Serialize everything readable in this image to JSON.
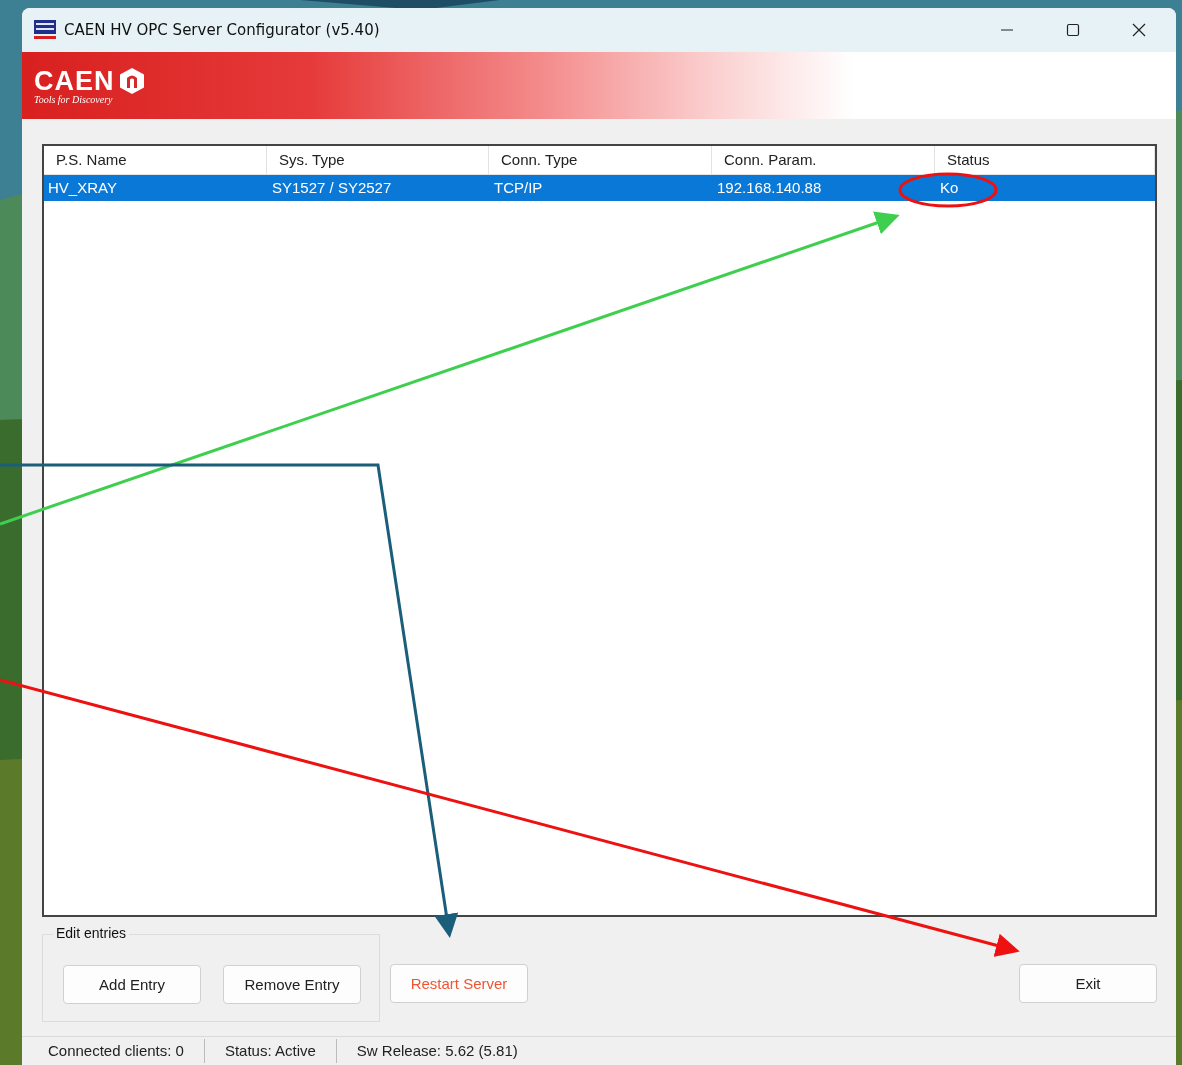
{
  "window": {
    "title": "CAEN HV OPC Server Configurator (v5.40)"
  },
  "banner": {
    "logo": "CAEN",
    "tagline": "Tools for Discovery"
  },
  "table": {
    "columns": [
      "P.S. Name",
      "Sys. Type",
      "Conn. Type",
      "Conn. Param.",
      "Status"
    ],
    "rows": [
      {
        "cells": [
          "HV_XRAY",
          "SY1527 / SY2527",
          "TCP/IP",
          "192.168.140.88",
          "Ko"
        ],
        "selected": true
      }
    ]
  },
  "edit_entries": {
    "label": "Edit entries",
    "buttons": [
      {
        "label": "Add Entry"
      },
      {
        "label": "Remove Entry"
      }
    ]
  },
  "restart_button": {
    "label": "Restart Server",
    "kind": "warning"
  },
  "exit_button": {
    "label": "Exit"
  },
  "status_bar": [
    "Connected clients: 0",
    "Status: Active",
    "Sw Release: 5.62 (5.81)"
  ]
}
